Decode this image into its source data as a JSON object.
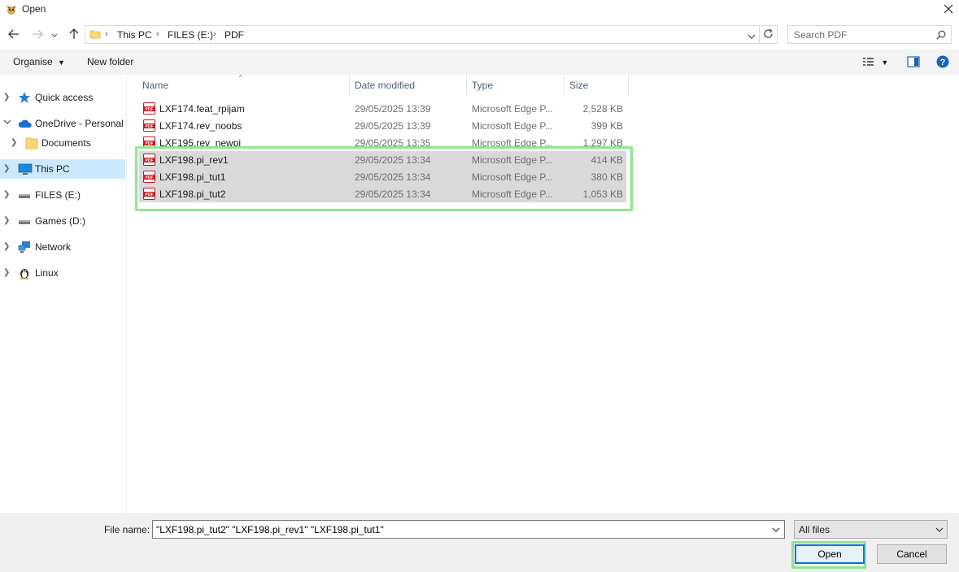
{
  "window": {
    "title": "Open"
  },
  "address": {
    "crumbs": [
      "This PC",
      "FILES (E:)",
      "PDF"
    ],
    "search_placeholder": "Search PDF"
  },
  "toolbar": {
    "organise_label": "Organise",
    "new_folder_label": "New folder"
  },
  "nav": {
    "items": [
      {
        "label": "Quick access",
        "icon": "star-icon"
      },
      {
        "label": "OneDrive - Personal",
        "icon": "cloud-icon"
      },
      {
        "label": "Documents",
        "icon": "folder-icon"
      },
      {
        "label": "This PC",
        "icon": "computer-icon",
        "selected": true
      },
      {
        "label": "FILES (E:)",
        "icon": "drive-icon"
      },
      {
        "label": "Games (D:)",
        "icon": "drive-icon"
      },
      {
        "label": "Network",
        "icon": "network-icon"
      },
      {
        "label": "Linux",
        "icon": "linux-penguin-icon"
      }
    ]
  },
  "files": {
    "columns": [
      "Name",
      "Date modified",
      "Type",
      "Size"
    ],
    "rows": [
      {
        "name": "LXF174.feat_rpijam",
        "date": "29/05/2025 13:39",
        "type": "Microsoft Edge P...",
        "size": "2,528 KB",
        "selected": false
      },
      {
        "name": "LXF174.rev_noobs",
        "date": "29/05/2025 13:39",
        "type": "Microsoft Edge P...",
        "size": "399 KB",
        "selected": false
      },
      {
        "name": "LXF195.rev_newpi",
        "date": "29/05/2025 13:35",
        "type": "Microsoft Edge P...",
        "size": "1,297 KB",
        "selected": false
      },
      {
        "name": "LXF198.pi_rev1",
        "date": "29/05/2025 13:34",
        "type": "Microsoft Edge P...",
        "size": "414 KB",
        "selected": true
      },
      {
        "name": "LXF198.pi_tut1",
        "date": "29/05/2025 13:34",
        "type": "Microsoft Edge P...",
        "size": "380 KB",
        "selected": true
      },
      {
        "name": "LXF198.pi_tut2",
        "date": "29/05/2025 13:34",
        "type": "Microsoft Edge P...",
        "size": "1,053 KB",
        "selected": true
      }
    ]
  },
  "bottom": {
    "file_name_label": "File name:",
    "file_name_value": "\"LXF198.pi_tut2\" \"LXF198.pi_rev1\" \"LXF198.pi_tut1\"",
    "file_type": "All files",
    "open_label": "Open",
    "cancel_label": "Cancel"
  },
  "colors": {
    "accent": "#0078d7",
    "selection_row": "#d9d9d9",
    "nav_selected": "#cce8ff",
    "highlight_box": "#8ee68e",
    "pdf_icon": "#c8161d"
  }
}
